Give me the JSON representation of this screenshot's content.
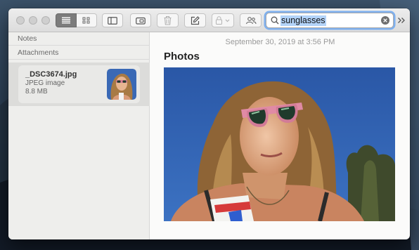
{
  "window": {
    "toolbar": {
      "search_value": "sunglasses"
    },
    "sidebar": {
      "sections": [
        "Notes",
        "Attachments"
      ],
      "attachment": {
        "filename": "_DSC3674.jpg",
        "kind": "JPEG image",
        "size": "8.8 MB"
      }
    },
    "note": {
      "date": "September 30, 2019 at 3:56 PM",
      "title": "Photos"
    }
  },
  "colors": {
    "search_focus_ring": "#7fb0ee",
    "selection_highlight": "#b3d3f8",
    "photo_sky": "#2f5fad"
  },
  "icons": [
    "list-view-icon",
    "gallery-view-icon",
    "sidebar-toggle-icon",
    "attachments-browser-icon",
    "trash-icon",
    "compose-icon",
    "lock-icon",
    "share-people-icon",
    "search-icon",
    "clear-icon",
    "overflow-icon"
  ]
}
